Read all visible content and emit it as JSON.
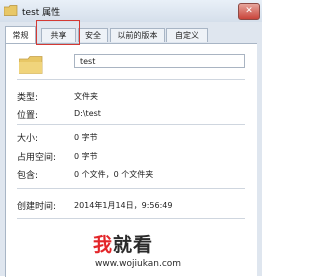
{
  "titlebar": {
    "title": "test 属性",
    "close_glyph": "✕"
  },
  "tabs": [
    {
      "label": "常规",
      "active": true
    },
    {
      "label": "共享",
      "active": false
    },
    {
      "label": "安全",
      "active": false
    },
    {
      "label": "以前的版本",
      "active": false
    },
    {
      "label": "自定义",
      "active": false
    }
  ],
  "general": {
    "name": "test",
    "rows": [
      {
        "label": "类型:",
        "value": "文件夹"
      },
      {
        "label": "位置:",
        "value": "D:\\test"
      },
      {
        "label": "大小:",
        "value": "0 字节"
      },
      {
        "label": "占用空间:",
        "value": "0 字节"
      },
      {
        "label": "包含:",
        "value": "0 个文件，0 个文件夹"
      },
      {
        "label": "创建时间:",
        "value": "2014年1月14日，9:56:49"
      }
    ]
  },
  "watermark": {
    "brand_part1": "我",
    "brand_part2": "就看",
    "url": "www.wojiukan.com"
  },
  "colors": {
    "highlight": "#d43a34",
    "folder": "#e8c766",
    "brand_red": "#e3262a"
  },
  "icons": {
    "title": "folder-icon",
    "close": "close-icon",
    "main": "folder-icon"
  }
}
